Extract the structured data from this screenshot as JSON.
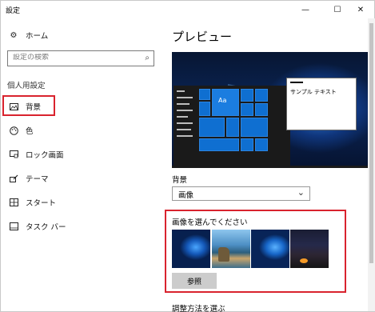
{
  "window": {
    "title": "設定",
    "minimize_glyph": "—",
    "maximize_glyph": "☐",
    "close_glyph": "✕"
  },
  "sidebar": {
    "home": {
      "label": "ホーム",
      "icon": "gear-icon"
    },
    "search": {
      "placeholder": "設定の検索",
      "value": "",
      "icon": "search-icon"
    },
    "section_heading": "個人用設定",
    "items": [
      {
        "label": "背景",
        "icon": "picture-icon",
        "selected": true
      },
      {
        "label": "色",
        "icon": "palette-icon",
        "selected": false
      },
      {
        "label": "ロック画面",
        "icon": "lock-screen-icon",
        "selected": false
      },
      {
        "label": "テーマ",
        "icon": "theme-brush-icon",
        "selected": false
      },
      {
        "label": "スタート",
        "icon": "start-icon",
        "selected": false
      },
      {
        "label": "タスク バー",
        "icon": "taskbar-icon",
        "selected": false
      }
    ]
  },
  "main": {
    "page_title": "プレビュー",
    "preview": {
      "tile_label": "Aa",
      "sample_text": "サンプル テキスト"
    },
    "background_label": "背景",
    "background_dropdown": {
      "selected": "画像"
    },
    "choose_picture_label": "画像を選んでください",
    "browse_button": "参照",
    "fit_label": "調整方法を選ぶ"
  },
  "colors": {
    "accent": "#0f6fd1",
    "highlight_outline": "#d9232e"
  }
}
